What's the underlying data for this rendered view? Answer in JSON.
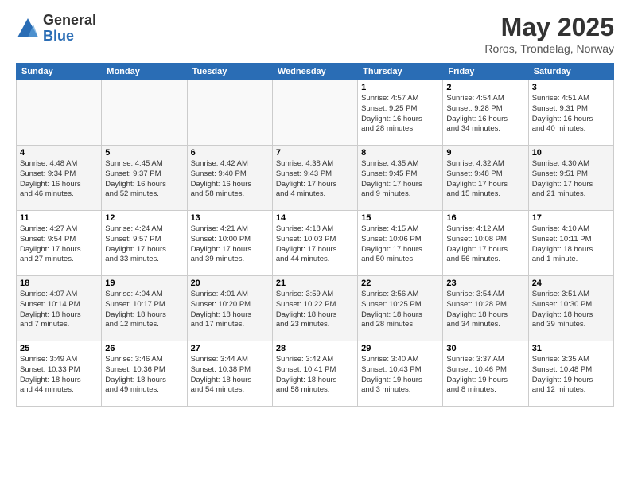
{
  "header": {
    "logo_general": "General",
    "logo_blue": "Blue",
    "month_title": "May 2025",
    "location": "Roros, Trondelag, Norway"
  },
  "days_of_week": [
    "Sunday",
    "Monday",
    "Tuesday",
    "Wednesday",
    "Thursday",
    "Friday",
    "Saturday"
  ],
  "weeks": [
    [
      {
        "day": "",
        "info": ""
      },
      {
        "day": "",
        "info": ""
      },
      {
        "day": "",
        "info": ""
      },
      {
        "day": "",
        "info": ""
      },
      {
        "day": "1",
        "info": "Sunrise: 4:57 AM\nSunset: 9:25 PM\nDaylight: 16 hours\nand 28 minutes."
      },
      {
        "day": "2",
        "info": "Sunrise: 4:54 AM\nSunset: 9:28 PM\nDaylight: 16 hours\nand 34 minutes."
      },
      {
        "day": "3",
        "info": "Sunrise: 4:51 AM\nSunset: 9:31 PM\nDaylight: 16 hours\nand 40 minutes."
      }
    ],
    [
      {
        "day": "4",
        "info": "Sunrise: 4:48 AM\nSunset: 9:34 PM\nDaylight: 16 hours\nand 46 minutes."
      },
      {
        "day": "5",
        "info": "Sunrise: 4:45 AM\nSunset: 9:37 PM\nDaylight: 16 hours\nand 52 minutes."
      },
      {
        "day": "6",
        "info": "Sunrise: 4:42 AM\nSunset: 9:40 PM\nDaylight: 16 hours\nand 58 minutes."
      },
      {
        "day": "7",
        "info": "Sunrise: 4:38 AM\nSunset: 9:43 PM\nDaylight: 17 hours\nand 4 minutes."
      },
      {
        "day": "8",
        "info": "Sunrise: 4:35 AM\nSunset: 9:45 PM\nDaylight: 17 hours\nand 9 minutes."
      },
      {
        "day": "9",
        "info": "Sunrise: 4:32 AM\nSunset: 9:48 PM\nDaylight: 17 hours\nand 15 minutes."
      },
      {
        "day": "10",
        "info": "Sunrise: 4:30 AM\nSunset: 9:51 PM\nDaylight: 17 hours\nand 21 minutes."
      }
    ],
    [
      {
        "day": "11",
        "info": "Sunrise: 4:27 AM\nSunset: 9:54 PM\nDaylight: 17 hours\nand 27 minutes."
      },
      {
        "day": "12",
        "info": "Sunrise: 4:24 AM\nSunset: 9:57 PM\nDaylight: 17 hours\nand 33 minutes."
      },
      {
        "day": "13",
        "info": "Sunrise: 4:21 AM\nSunset: 10:00 PM\nDaylight: 17 hours\nand 39 minutes."
      },
      {
        "day": "14",
        "info": "Sunrise: 4:18 AM\nSunset: 10:03 PM\nDaylight: 17 hours\nand 44 minutes."
      },
      {
        "day": "15",
        "info": "Sunrise: 4:15 AM\nSunset: 10:06 PM\nDaylight: 17 hours\nand 50 minutes."
      },
      {
        "day": "16",
        "info": "Sunrise: 4:12 AM\nSunset: 10:08 PM\nDaylight: 17 hours\nand 56 minutes."
      },
      {
        "day": "17",
        "info": "Sunrise: 4:10 AM\nSunset: 10:11 PM\nDaylight: 18 hours\nand 1 minute."
      }
    ],
    [
      {
        "day": "18",
        "info": "Sunrise: 4:07 AM\nSunset: 10:14 PM\nDaylight: 18 hours\nand 7 minutes."
      },
      {
        "day": "19",
        "info": "Sunrise: 4:04 AM\nSunset: 10:17 PM\nDaylight: 18 hours\nand 12 minutes."
      },
      {
        "day": "20",
        "info": "Sunrise: 4:01 AM\nSunset: 10:20 PM\nDaylight: 18 hours\nand 17 minutes."
      },
      {
        "day": "21",
        "info": "Sunrise: 3:59 AM\nSunset: 10:22 PM\nDaylight: 18 hours\nand 23 minutes."
      },
      {
        "day": "22",
        "info": "Sunrise: 3:56 AM\nSunset: 10:25 PM\nDaylight: 18 hours\nand 28 minutes."
      },
      {
        "day": "23",
        "info": "Sunrise: 3:54 AM\nSunset: 10:28 PM\nDaylight: 18 hours\nand 34 minutes."
      },
      {
        "day": "24",
        "info": "Sunrise: 3:51 AM\nSunset: 10:30 PM\nDaylight: 18 hours\nand 39 minutes."
      }
    ],
    [
      {
        "day": "25",
        "info": "Sunrise: 3:49 AM\nSunset: 10:33 PM\nDaylight: 18 hours\nand 44 minutes."
      },
      {
        "day": "26",
        "info": "Sunrise: 3:46 AM\nSunset: 10:36 PM\nDaylight: 18 hours\nand 49 minutes."
      },
      {
        "day": "27",
        "info": "Sunrise: 3:44 AM\nSunset: 10:38 PM\nDaylight: 18 hours\nand 54 minutes."
      },
      {
        "day": "28",
        "info": "Sunrise: 3:42 AM\nSunset: 10:41 PM\nDaylight: 18 hours\nand 58 minutes."
      },
      {
        "day": "29",
        "info": "Sunrise: 3:40 AM\nSunset: 10:43 PM\nDaylight: 19 hours\nand 3 minutes."
      },
      {
        "day": "30",
        "info": "Sunrise: 3:37 AM\nSunset: 10:46 PM\nDaylight: 19 hours\nand 8 minutes."
      },
      {
        "day": "31",
        "info": "Sunrise: 3:35 AM\nSunset: 10:48 PM\nDaylight: 19 hours\nand 12 minutes."
      }
    ]
  ]
}
